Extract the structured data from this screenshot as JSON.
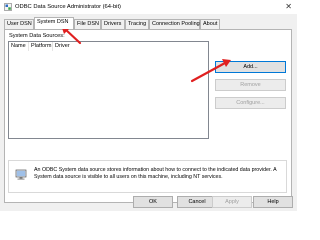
{
  "window": {
    "title": "ODBC Data Source Administrator (64-bit)",
    "close_glyph": "✕"
  },
  "tabs": [
    {
      "label": "User DSN"
    },
    {
      "label": "System DSN"
    },
    {
      "label": "File DSN"
    },
    {
      "label": "Drivers"
    },
    {
      "label": "Tracing"
    },
    {
      "label": "Connection Pooling"
    },
    {
      "label": "About"
    }
  ],
  "active_tab": "System DSN",
  "panel": {
    "section_label": "System Data Sources:",
    "columns": [
      "Name",
      "Platform",
      "Driver"
    ],
    "buttons": {
      "add": "Add...",
      "remove": "Remove",
      "configure": "Configure..."
    },
    "info_text": "An ODBC System data source stores information about how to connect to the indicated data provider.  A System data source is visible to all users on this machine, including NT services."
  },
  "footer": {
    "ok": "OK",
    "cancel": "Cancel",
    "apply": "Apply",
    "help": "Help"
  },
  "colors": {
    "annotation_arrow": "#e02020",
    "accent": "#0078d7"
  },
  "icons": {
    "app": "odbc-app-icon",
    "info": "info-computer-icon"
  }
}
